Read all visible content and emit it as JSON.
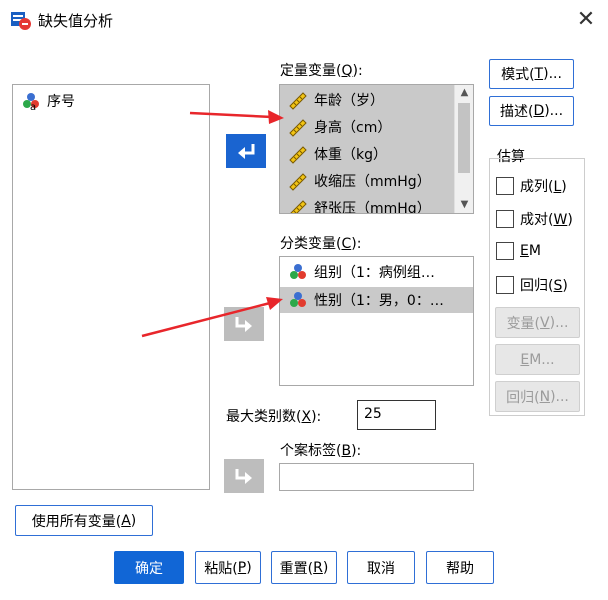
{
  "window": {
    "title": "缺失值分析",
    "close_glyph": "✕"
  },
  "source_list": {
    "items": [
      {
        "label": "序号",
        "icon": "nominal-variable-icon"
      }
    ]
  },
  "quant_vars": {
    "label": "定量变量(",
    "mnemonic": "Q",
    "label_end": "):",
    "items": [
      {
        "label": "年龄（岁）",
        "icon": "scale-ruler-icon"
      },
      {
        "label": "身高（cm）",
        "icon": "scale-ruler-icon"
      },
      {
        "label": "体重（kg）",
        "icon": "scale-ruler-icon"
      },
      {
        "label": "收缩压（mmHg）",
        "icon": "scale-ruler-icon"
      },
      {
        "label": "舒张压（mmHg）",
        "icon": "scale-ruler-icon"
      }
    ]
  },
  "cat_vars": {
    "label": "分类变量(",
    "mnemonic": "C",
    "label_end": "):",
    "items": [
      {
        "label": "组别（1：病例组…",
        "icon": "nominal-variable-icon",
        "selected": false
      },
      {
        "label": "性别（1：男，0：…",
        "icon": "nominal-variable-icon",
        "selected": true
      }
    ]
  },
  "max_categories": {
    "label": "最大类别数(",
    "mnemonic": "X",
    "label_end": "):",
    "value": "25"
  },
  "case_labels": {
    "label": "个案标签(",
    "mnemonic": "B",
    "label_end": "):",
    "value": ""
  },
  "side_buttons": {
    "patterns": {
      "label": "模式(",
      "mnemonic": "T",
      "end": ")..."
    },
    "descriptives": {
      "label": "描述(",
      "mnemonic": "D",
      "end": ")..."
    }
  },
  "estimation": {
    "title": "估算",
    "options": [
      {
        "label": "成列(",
        "mnemonic": "L",
        "end": ")",
        "checked": false
      },
      {
        "label": "成对(",
        "mnemonic": "W",
        "end": ")",
        "checked": false
      },
      {
        "label": "",
        "mnemonic": "E",
        "end": "M",
        "checked": false
      },
      {
        "label": "回归(",
        "mnemonic": "S",
        "end": ")",
        "checked": false
      }
    ],
    "buttons": [
      {
        "label": "变量(",
        "mnemonic": "V",
        "end": ")..."
      },
      {
        "label": "",
        "mnemonic": "E",
        "end": "M..."
      },
      {
        "label": "回归(",
        "mnemonic": "N",
        "end": ")..."
      }
    ]
  },
  "use_all_button": {
    "label": "使用所有变量(",
    "mnemonic": "A",
    "end": ")"
  },
  "footer": {
    "ok": "确定",
    "paste": {
      "label": "粘贴(",
      "mnemonic": "P",
      "end": ")"
    },
    "reset": {
      "label": "重置(",
      "mnemonic": "R",
      "end": ")"
    },
    "cancel": "取消",
    "help": "帮助"
  },
  "colors": {
    "primary": "#1166d6",
    "selection": "#c9c9c9",
    "annotation_arrow": "#e8262b"
  }
}
